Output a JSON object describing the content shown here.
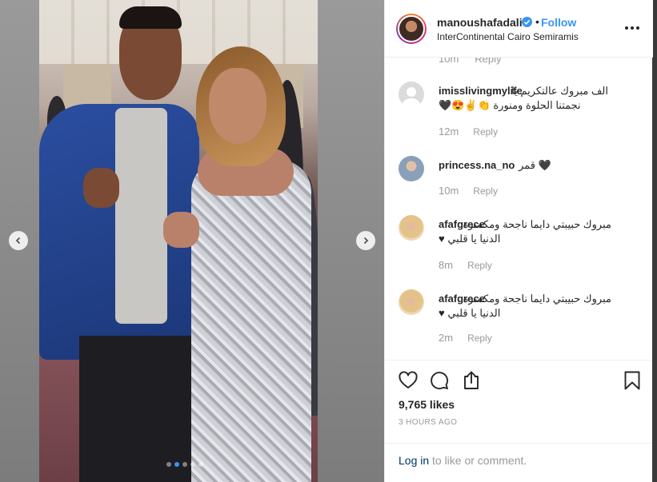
{
  "post": {
    "username": "manoushafadali",
    "follow_label": "Follow",
    "separator": "•",
    "location": "InterContinental Cairo Semiramis",
    "likes": "9,765 likes",
    "time_ago": "3 HOURS AGO",
    "login_link": "Log in",
    "login_text": "to like or comment.",
    "carousel": {
      "slide_count": 5,
      "active_slide": 1
    }
  },
  "partial_comment": {
    "time": "10m",
    "reply": "Reply"
  },
  "comments": [
    {
      "username": "imisslivingmylife",
      "line1": "الف مبروك عالتكريم يا",
      "line2": "نجمتنا الحلوة ومنورة 👏✌😍🖤",
      "time": "12m",
      "reply": "Reply",
      "avatar": "default-avatar"
    },
    {
      "username": "princess.na_no",
      "line1": "قمر 🖤",
      "line2": "",
      "time": "10m",
      "reply": "Reply",
      "avatar": "photo-avatar"
    },
    {
      "username": "afafgrece",
      "line1": "مبروك حبيبتي دايما ناجحة ومكسرة",
      "line2": "الدنيا يا قلبي ♥",
      "time": "8m",
      "reply": "Reply",
      "avatar": "photo-avatar"
    },
    {
      "username": "afafgrece",
      "line1": "مبروك حبيبتي دايما ناجحة ومكسرة",
      "line2": "الدنيا يا قلبي ♥",
      "time": "2m",
      "reply": "Reply",
      "avatar": "photo-avatar"
    }
  ],
  "icons": {
    "like": "heart-icon",
    "comment": "comment-bubble-icon",
    "share": "share-icon",
    "save": "bookmark-icon",
    "more": "more-options-icon",
    "verified": "verified-badge-icon",
    "prev": "chevron-left-icon",
    "next": "chevron-right-icon"
  },
  "colors": {
    "link_blue": "#3897f0",
    "text": "#262626",
    "muted": "#999999",
    "login_link": "#003569"
  }
}
